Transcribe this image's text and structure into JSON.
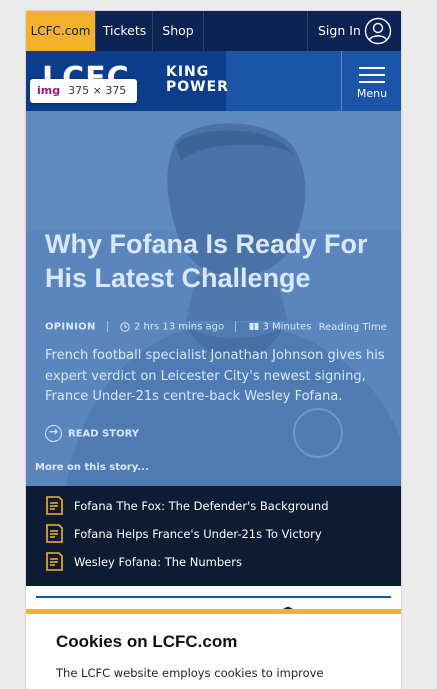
{
  "topbar": {
    "home_link": "LCFC.com",
    "tickets": "Tickets",
    "shop": "Shop",
    "sign_in": "Sign In"
  },
  "brand": {
    "logo_text": "LCFC",
    "sponsor_line1": "KING",
    "sponsor_line2": "POWER",
    "menu_label": "Menu"
  },
  "inspector_tag": {
    "element": "img",
    "dimensions": "375 × 375"
  },
  "article": {
    "headline": "Why Fofana Is Ready For His Latest Challenge",
    "category": "OPINION",
    "time_ago": "2 hrs 13 mins ago",
    "read_time": "3 Minutes",
    "read_time_suffix": "Reading Time",
    "summary": "French football specialist Jonathan Johnson gives his expert verdict on Leicester City's newest signing, France Under-21s centre-back Wesley Fofana.",
    "read_story": "READ STORY",
    "more_on_story": "More on this story..."
  },
  "related": [
    {
      "title": "Fofana The Fox: The Defender's Background"
    },
    {
      "title": "Fofana Helps France's Under-21s To Victory"
    },
    {
      "title": "Wesley Fofana: The Numbers"
    }
  ],
  "cookie": {
    "title": "Cookies on LCFC.com",
    "body": "The LCFC website employs cookies to improve"
  },
  "colors": {
    "navy": "#0b2253",
    "royal_blue": "#1a55a8",
    "gold": "#f3b229",
    "hero_overlay": "#5b86bd",
    "dark_panel": "#0e1c33"
  }
}
